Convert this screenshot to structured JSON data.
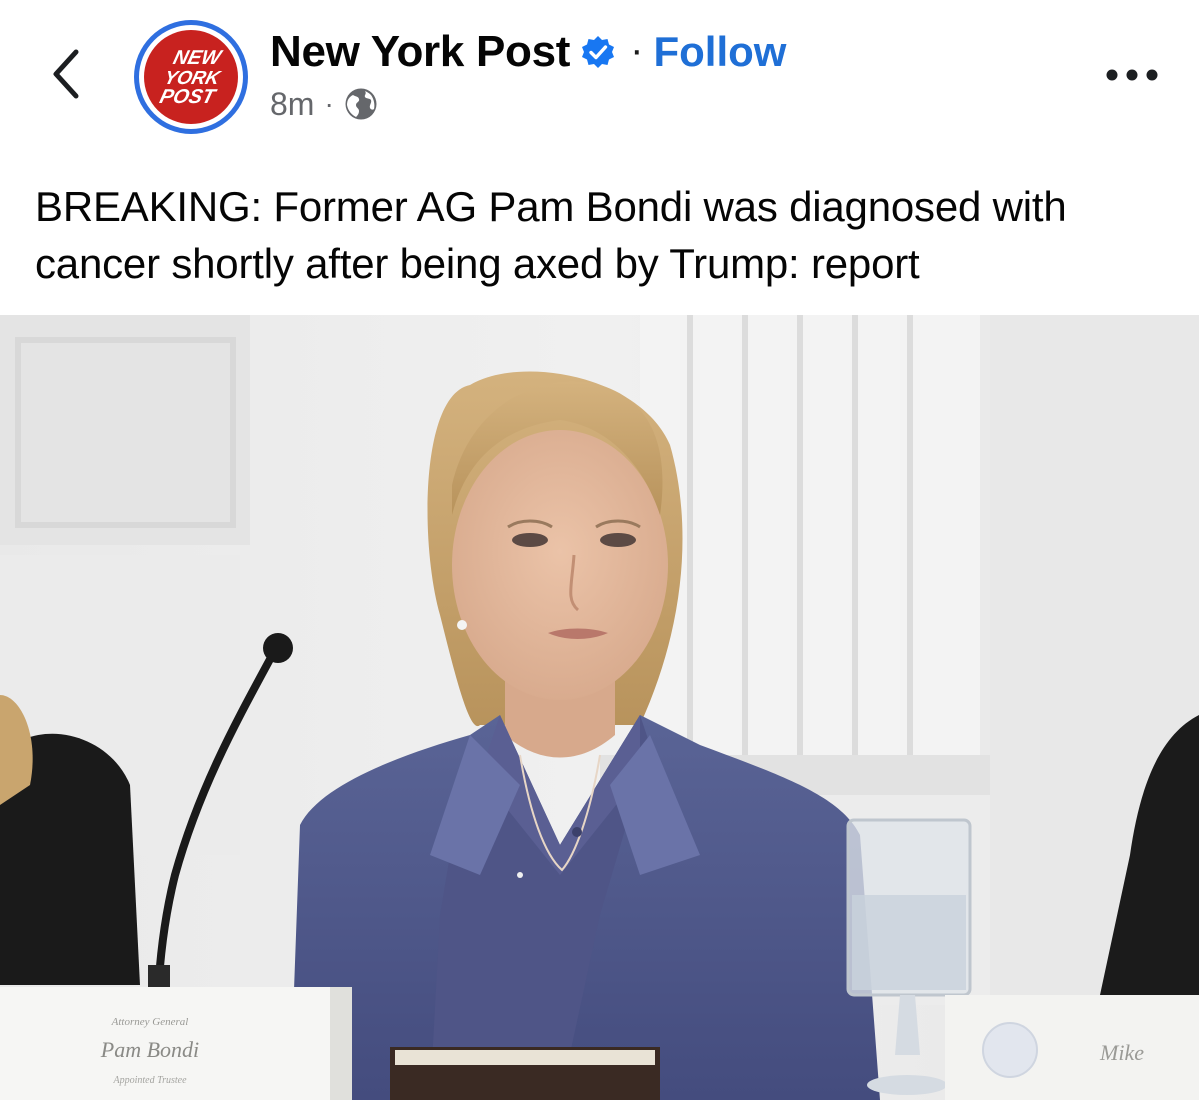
{
  "post": {
    "page_name": "New York Post",
    "follow_label": "Follow",
    "separator": "·",
    "timestamp": "8m",
    "meta_separator": "·",
    "headline": "BREAKING: Former AG Pam Bondi was diagnosed with cancer shortly after being axed by Trump: report"
  },
  "logo": {
    "line1": "NEW",
    "line2": "YORK",
    "line3": "POST"
  },
  "photo": {
    "left_placard": {
      "title": "Attorney General",
      "name": "Pam Bondi",
      "role": "Appointed Trustee"
    },
    "right_placard": {
      "name": "Mike"
    }
  },
  "colors": {
    "accent": "#1f6fd6",
    "verified": "#1877f2",
    "logo_red": "#c8221f",
    "logo_ring": "#2f6fe0",
    "meta_gray": "#65676b"
  },
  "icons": {
    "back": "chevron-left-icon",
    "verified": "verified-badge-icon",
    "privacy": "globe-icon",
    "more": "more-horizontal-icon"
  }
}
